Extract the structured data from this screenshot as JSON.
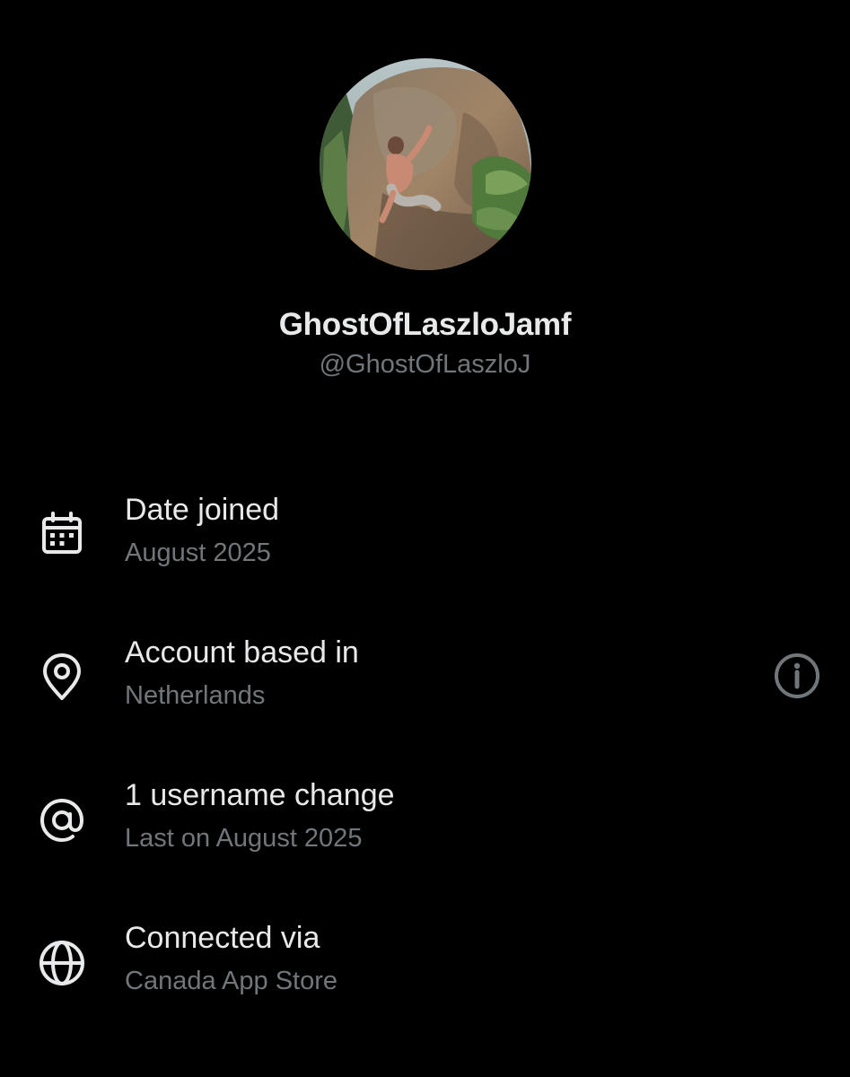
{
  "profile": {
    "display_name": "GhostOfLaszloJamf",
    "handle": "@GhostOfLaszloJ"
  },
  "details": [
    {
      "label": "Date joined",
      "value": "August 2025",
      "icon": "calendar-icon"
    },
    {
      "label": "Account based in",
      "value": "Netherlands",
      "icon": "location-pin-icon"
    },
    {
      "label": "1 username change",
      "value": "Last on August 2025",
      "icon": "at-sign-icon"
    },
    {
      "label": "Connected via",
      "value": "Canada App Store",
      "icon": "globe-icon"
    }
  ],
  "colors": {
    "background": "#000000",
    "primary_text": "#e7e9ea",
    "secondary_text": "#71767b"
  }
}
